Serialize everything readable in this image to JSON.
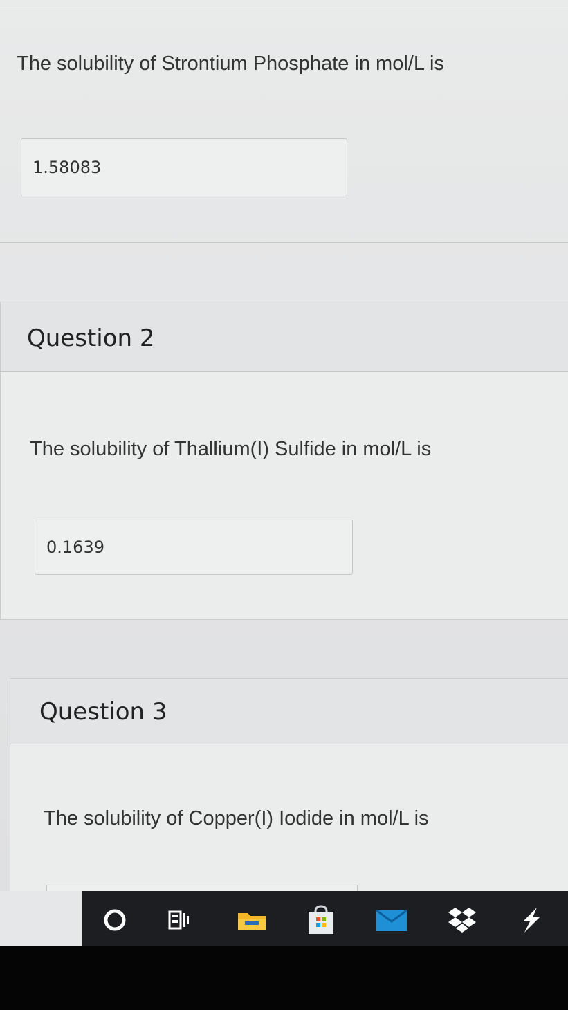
{
  "questions": [
    {
      "title": "",
      "text": "The solubility of Strontium Phosphate in mol/L is",
      "answer": "1.58083"
    },
    {
      "title": "Question 2",
      "text": "The solubility of Thallium(I) Sulfide in mol/L is",
      "answer": "0.1639"
    },
    {
      "title": "Question 3",
      "text": "The solubility of Copper(I) Iodide in mol/L is",
      "answer": ""
    }
  ],
  "taskbar": {
    "icons": [
      "cortana-circle-icon",
      "task-view-icon",
      "file-explorer-icon",
      "store-icon",
      "mail-icon",
      "dropbox-icon",
      "power-bi-icon"
    ]
  },
  "colors": {
    "page_bg": "#e6e7e8",
    "taskbar_bg": "#1c1e22",
    "folder": "#f2b626",
    "mail": "#1f8fd6"
  }
}
